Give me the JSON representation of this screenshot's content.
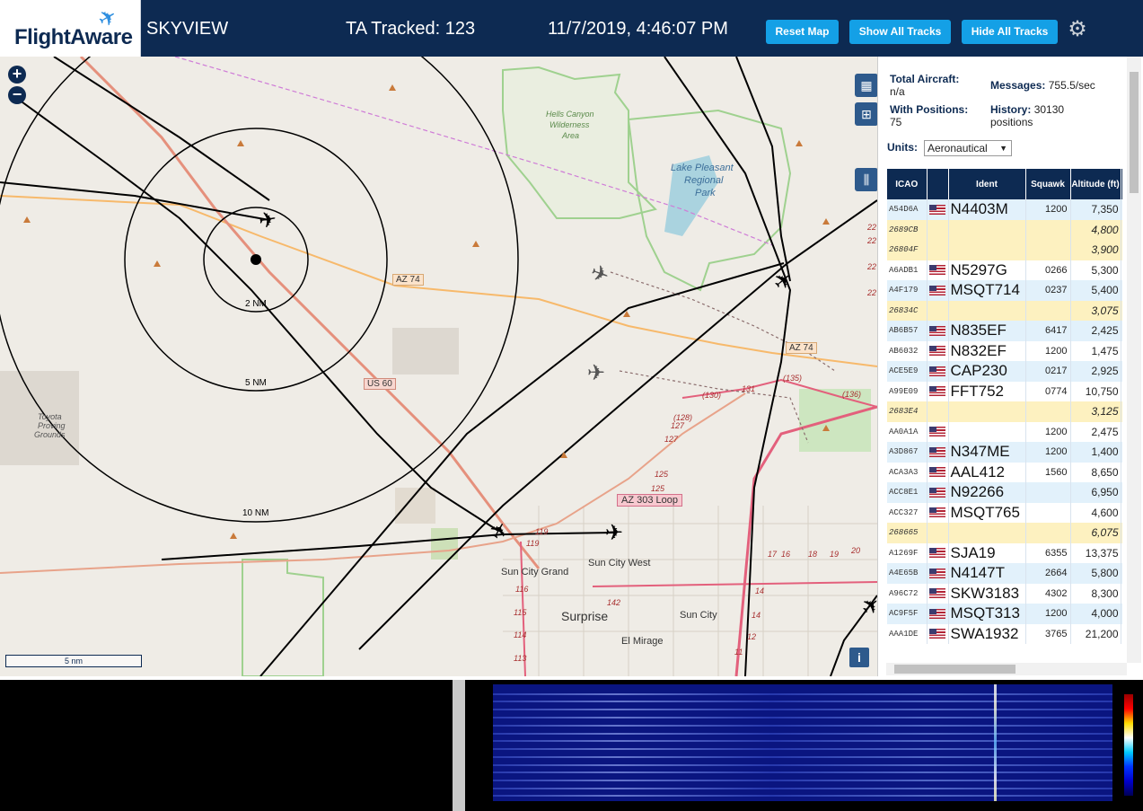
{
  "header": {
    "logo_text": "FlightAware",
    "app_name": "SKYVIEW",
    "tracked": "TA Tracked: 123",
    "datetime": "11/7/2019, 4:46:07 PM",
    "reset_map": "Reset Map",
    "show_all": "Show All Tracks",
    "hide_all": "Hide All Tracks"
  },
  "map": {
    "zoom_in": "+",
    "zoom_out": "−",
    "scale": "5 nm",
    "info": "i",
    "ring_labels": [
      "2 NM",
      "5 NM",
      "10 NM"
    ],
    "place_labels": [
      "Hells Canyon",
      "Wilderness",
      "Area",
      "Lake Pleasant",
      "Regional",
      "Park",
      "Toyota",
      "Proving",
      "Grounds",
      "Sun City Grand",
      "Sun City West",
      "Surprise",
      "Sun City",
      "El Mirage"
    ],
    "road_labels": [
      "AZ 74",
      "AZ 74",
      "US 60",
      "AZ 303 Loop"
    ],
    "road_numbers": [
      "(130)",
      "131",
      "(135)",
      "(136)",
      "(128)",
      "127",
      "127",
      "125",
      "125",
      "119",
      "119",
      "116",
      "115",
      "114",
      "113",
      "142",
      "17",
      "16",
      "18",
      "19",
      "20",
      "14",
      "14",
      "12",
      "11",
      "22",
      "22",
      "22",
      "22"
    ]
  },
  "stats": {
    "total_label": "Total Aircraft:",
    "total_value": "n/a",
    "messages_label": "Messages:",
    "messages_value": "755.5/sec",
    "positions_label": "With Positions:",
    "positions_value": "75",
    "history_label": "History:",
    "history_value": "30130",
    "history_unit": "positions",
    "units_label": "Units:",
    "units_value": "Aeronautical"
  },
  "table": {
    "headers": [
      "ICAO",
      "",
      "Ident",
      "Squawk",
      "Altitude (ft)"
    ],
    "rows": [
      {
        "icao": "A54D6A",
        "flag": true,
        "ident": "N4403M",
        "squawk": "1200",
        "alt": "7,350",
        "trend": "",
        "hl": false
      },
      {
        "icao": "2689CB",
        "flag": false,
        "ident": "",
        "squawk": "",
        "alt": "4,800",
        "trend": "▲",
        "hl": true
      },
      {
        "icao": "26804F",
        "flag": false,
        "ident": "",
        "squawk": "",
        "alt": "3,900",
        "trend": "",
        "hl": true
      },
      {
        "icao": "A6ADB1",
        "flag": true,
        "ident": "N5297G",
        "squawk": "0266",
        "alt": "5,300",
        "trend": "",
        "hl": false
      },
      {
        "icao": "A4F179",
        "flag": true,
        "ident": "MSQT714",
        "squawk": "0237",
        "alt": "5,400",
        "trend": "",
        "hl": false
      },
      {
        "icao": "26834C",
        "flag": false,
        "ident": "",
        "squawk": "",
        "alt": "3,075",
        "trend": "▲",
        "hl": true
      },
      {
        "icao": "AB6B57",
        "flag": true,
        "ident": "N835EF",
        "squawk": "6417",
        "alt": "2,425",
        "trend": "▲",
        "hl": false
      },
      {
        "icao": "AB6032",
        "flag": true,
        "ident": "N832EF",
        "squawk": "1200",
        "alt": "1,475",
        "trend": "",
        "hl": false
      },
      {
        "icao": "ACE5E9",
        "flag": true,
        "ident": "CAP230",
        "squawk": "0217",
        "alt": "2,925",
        "trend": "",
        "hl": false
      },
      {
        "icao": "A99E09",
        "flag": true,
        "ident": "FFT752",
        "squawk": "0774",
        "alt": "10,750",
        "trend": "▲",
        "hl": false
      },
      {
        "icao": "2683E4",
        "flag": false,
        "ident": "",
        "squawk": "",
        "alt": "3,125",
        "trend": "",
        "hl": true
      },
      {
        "icao": "AA0A1A",
        "flag": true,
        "ident": "",
        "squawk": "1200",
        "alt": "2,475",
        "trend": "▼",
        "hl": false
      },
      {
        "icao": "A3D867",
        "flag": true,
        "ident": "N347ME",
        "squawk": "1200",
        "alt": "1,400",
        "trend": "▼",
        "hl": false
      },
      {
        "icao": "ACA3A3",
        "flag": true,
        "ident": "AAL412",
        "squawk": "1560",
        "alt": "8,650",
        "trend": "▲",
        "hl": false
      },
      {
        "icao": "ACC8E1",
        "flag": true,
        "ident": "N92266",
        "squawk": "",
        "alt": "6,950",
        "trend": "",
        "hl": false
      },
      {
        "icao": "ACC327",
        "flag": true,
        "ident": "MSQT765",
        "squawk": "",
        "alt": "4,600",
        "trend": "▼",
        "hl": false
      },
      {
        "icao": "268665",
        "flag": false,
        "ident": "",
        "squawk": "",
        "alt": "6,075",
        "trend": "▲",
        "hl": true
      },
      {
        "icao": "A1269F",
        "flag": true,
        "ident": "SJA19",
        "squawk": "6355",
        "alt": "13,375",
        "trend": "▼",
        "hl": false
      },
      {
        "icao": "A4E65B",
        "flag": true,
        "ident": "N4147T",
        "squawk": "2664",
        "alt": "5,800",
        "trend": "",
        "hl": false
      },
      {
        "icao": "A96C72",
        "flag": true,
        "ident": "SKW3183",
        "squawk": "4302",
        "alt": "8,300",
        "trend": "▼",
        "hl": false
      },
      {
        "icao": "AC9F5F",
        "flag": true,
        "ident": "MSQT313",
        "squawk": "1200",
        "alt": "4,000",
        "trend": "▼",
        "hl": false
      },
      {
        "icao": "AAA1DE",
        "flag": true,
        "ident": "SWA1932",
        "squawk": "3765",
        "alt": "21,200",
        "trend": "▼",
        "hl": false
      }
    ]
  },
  "colors": {
    "header_bg": "#0d2a52",
    "button_bg": "#14a0e6",
    "row_bg": "#e2f1fb",
    "highlight_row_bg": "#fdf1c0",
    "waterfall_bg": "#0a1580"
  },
  "icons": {
    "gear": "gear-icon",
    "layers": "map-layers-icon",
    "grid": "grid-icon",
    "columns": "columns-icon"
  }
}
